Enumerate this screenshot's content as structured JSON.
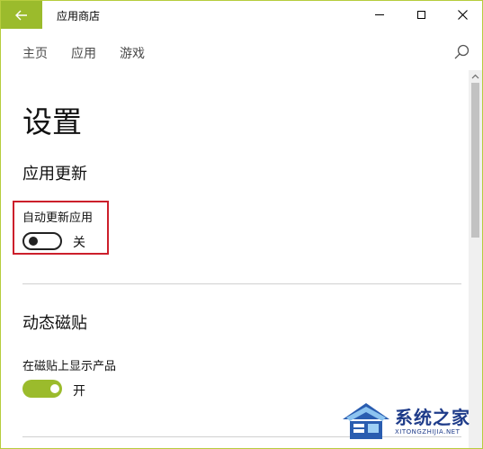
{
  "titlebar": {
    "app_title": "应用商店",
    "back_icon": "arrow-left-icon",
    "accent_color": "#9bbb2c"
  },
  "nav": {
    "items": [
      "主页",
      "应用",
      "游戏"
    ],
    "search_icon": "search-icon"
  },
  "page": {
    "title": "设置"
  },
  "sections": {
    "app_updates": {
      "title": "应用更新",
      "setting_label": "自动更新应用",
      "toggle_on": false,
      "state_label": "关"
    },
    "live_tiles": {
      "title": "动态磁贴",
      "setting_label": "在磁贴上显示产品",
      "toggle_on": true,
      "state_label": "开"
    }
  },
  "watermark": {
    "text": "系统之家",
    "url": "XITONGZHIJIA.NET"
  }
}
